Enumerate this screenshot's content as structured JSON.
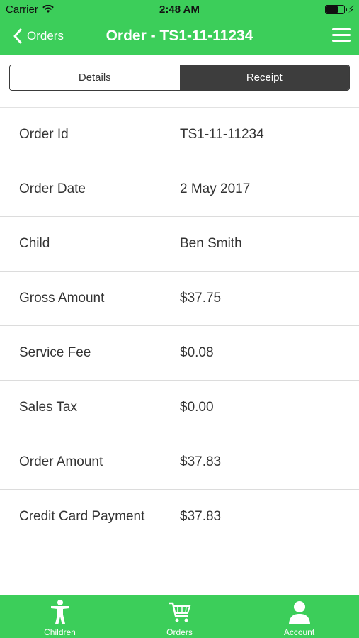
{
  "status_bar": {
    "carrier": "Carrier",
    "time": "2:48 AM"
  },
  "nav": {
    "back_label": "Orders",
    "title": "Order - TS1-11-11234"
  },
  "segments": [
    {
      "label": "Details",
      "selected": false
    },
    {
      "label": "Receipt",
      "selected": true
    }
  ],
  "receipt_rows": [
    {
      "label": "Order Id",
      "value": "TS1-11-11234"
    },
    {
      "label": "Order Date",
      "value": "2 May 2017"
    },
    {
      "label": "Child",
      "value": "Ben Smith"
    },
    {
      "label": "Gross Amount",
      "value": "$37.75"
    },
    {
      "label": "Service Fee",
      "value": "$0.08"
    },
    {
      "label": "Sales Tax",
      "value": "$0.00"
    },
    {
      "label": "Order Amount",
      "value": "$37.83"
    },
    {
      "label": "Credit Card Payment",
      "value": "$37.83"
    }
  ],
  "tabs": [
    {
      "label": "Children",
      "icon": "child-icon"
    },
    {
      "label": "Orders",
      "icon": "cart-icon"
    },
    {
      "label": "Account",
      "icon": "user-icon"
    }
  ],
  "colors": {
    "brand_green": "#3cce5a",
    "segment_active": "#3d3d3d"
  }
}
